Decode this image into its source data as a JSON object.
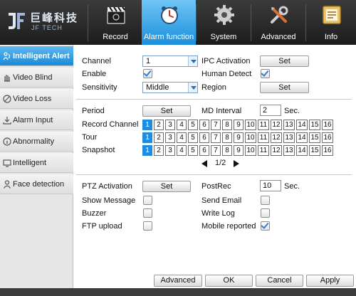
{
  "brand": {
    "cn": "巨峰科技",
    "en": "JF TECH"
  },
  "tabs": [
    {
      "id": "record",
      "label": "Record",
      "icon": "clapperboard-icon"
    },
    {
      "id": "alarm",
      "label": "Alarm function",
      "icon": "alarm-clock-icon",
      "active": true
    },
    {
      "id": "system",
      "label": "System",
      "icon": "gear-icon"
    },
    {
      "id": "advanced",
      "label": "Advanced",
      "icon": "tools-icon"
    },
    {
      "id": "info",
      "label": "Info",
      "icon": "info-document-icon"
    }
  ],
  "sidebar": {
    "items": [
      {
        "label": "Intelligent Alert",
        "icon": "person-motion-icon",
        "active": true
      },
      {
        "label": "Video Blind",
        "icon": "hand-icon"
      },
      {
        "label": "Video Loss",
        "icon": "no-signal-icon"
      },
      {
        "label": "Alarm Input",
        "icon": "download-tray-icon"
      },
      {
        "label": "Abnormality",
        "icon": "info-circle-icon"
      },
      {
        "label": "Intelligent",
        "icon": "monitor-icon"
      },
      {
        "label": "Face detection",
        "icon": "person-icon"
      }
    ]
  },
  "form": {
    "channel_label": "Channel",
    "channel_value": "1",
    "ipc_activation_label": "IPC Activation",
    "ipc_set_label": "Set",
    "enable_label": "Enable",
    "enable_checked": true,
    "human_detect_label": "Human Detect",
    "human_detect_checked": true,
    "sensitivity_label": "Sensitivity",
    "sensitivity_value": "Middle",
    "region_label": "Region",
    "region_set_label": "Set",
    "period_label": "Period",
    "period_set_label": "Set",
    "md_interval_label": "MD Interval",
    "md_interval_value": "2",
    "md_interval_unit": "Sec.",
    "record_channel_label": "Record Channel",
    "tour_label": "Tour",
    "snapshot_label": "Snapshot",
    "channels": [
      "1",
      "2",
      "3",
      "4",
      "5",
      "6",
      "7",
      "8",
      "9",
      "10",
      "11",
      "12",
      "13",
      "14",
      "15",
      "16"
    ],
    "record_channel_selected": [
      "1"
    ],
    "tour_selected": [
      "1"
    ],
    "snapshot_selected": [
      "1"
    ],
    "page_indicator": "1/2",
    "ptz_activation_label": "PTZ Activation",
    "ptz_set_label": "Set",
    "postrec_label": "PostRec",
    "postrec_value": "10",
    "postrec_unit": "Sec.",
    "show_message_label": "Show Message",
    "show_message_checked": false,
    "send_email_label": "Send Email",
    "send_email_checked": false,
    "buzzer_label": "Buzzer",
    "buzzer_checked": false,
    "write_log_label": "Write Log",
    "write_log_checked": false,
    "ftp_upload_label": "FTP upload",
    "ftp_upload_checked": false,
    "mobile_reported_label": "Mobile reported",
    "mobile_reported_checked": true
  },
  "footer": {
    "advanced_label": "Advanced",
    "ok_label": "OK",
    "cancel_label": "Cancel",
    "apply_label": "Apply"
  },
  "colors": {
    "accent": "#1f8ce0",
    "header_bg": "#2a2a2a",
    "sidebar_bg": "#e6e6e6"
  }
}
